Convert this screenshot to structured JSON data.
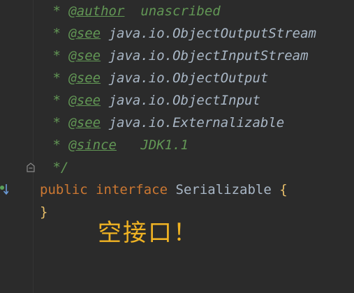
{
  "code": {
    "doc_star": " *",
    "doc_end": " */",
    "author_tag": "@author",
    "author_value": "unascribed",
    "see_tag": "@see",
    "see_refs": [
      "java.io.ObjectOutputStream",
      "java.io.ObjectInputStream",
      "java.io.ObjectOutput",
      "java.io.ObjectInput",
      "java.io.Externalizable"
    ],
    "since_tag": "@since",
    "since_value": "JDK1.1",
    "kw_public": "public",
    "kw_interface": "interface",
    "class_name": "Serializable",
    "open_brace": "{",
    "close_brace": "}"
  },
  "annotation": {
    "text": "空接口！"
  },
  "colors": {
    "background": "#2b2b2b",
    "doc_comment": "#629755",
    "keyword": "#cc7832",
    "identifier": "#a9b7c6",
    "brace": "#e8bf6a",
    "annotation": "#f0b323"
  },
  "icons": {
    "fold": "fold-marker-icon",
    "implement": "implemented-gutter-icon"
  }
}
